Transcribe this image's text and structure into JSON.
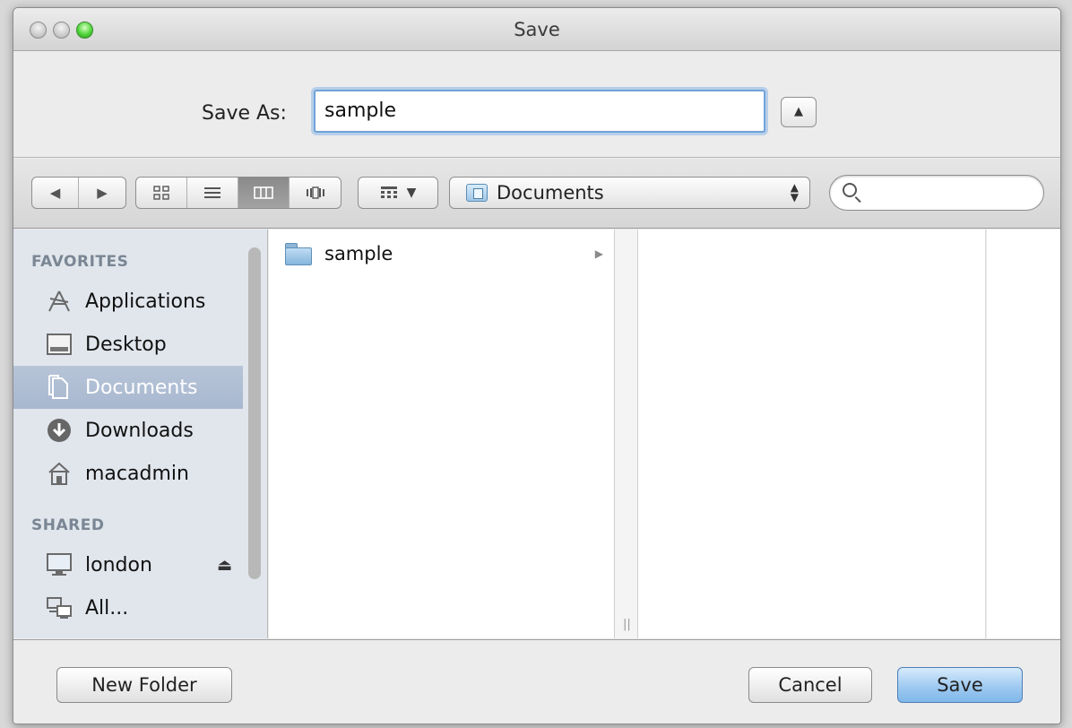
{
  "window": {
    "title": "Save"
  },
  "save_as": {
    "label": "Save As:",
    "value": "sample"
  },
  "toolbar": {
    "nav_back": "◀",
    "nav_forward": "▶",
    "view_modes": [
      "icon",
      "list",
      "column",
      "coverflow"
    ],
    "active_view": "column",
    "location": "Documents",
    "search_placeholder": ""
  },
  "sidebar": {
    "favorites_header": "FAVORITES",
    "favorites": [
      {
        "label": "Applications",
        "icon": "applications-icon"
      },
      {
        "label": "Desktop",
        "icon": "desktop-icon"
      },
      {
        "label": "Documents",
        "icon": "documents-icon",
        "selected": true
      },
      {
        "label": "Downloads",
        "icon": "downloads-icon"
      },
      {
        "label": "macadmin",
        "icon": "home-icon"
      }
    ],
    "shared_header": "SHARED",
    "shared": [
      {
        "label": "london",
        "icon": "computer-icon"
      },
      {
        "label": "All...",
        "icon": "network-icon"
      }
    ]
  },
  "browser": {
    "column1": [
      {
        "label": "sample",
        "icon": "folder-icon"
      }
    ]
  },
  "buttons": {
    "new_folder": "New Folder",
    "cancel": "Cancel",
    "save": "Save"
  },
  "colors": {
    "sidebar_bg": "#e1e6ed",
    "selection": "#a8b8cf",
    "default_button": "#9fcaf1",
    "focus_ring": "#6fa3d8"
  }
}
